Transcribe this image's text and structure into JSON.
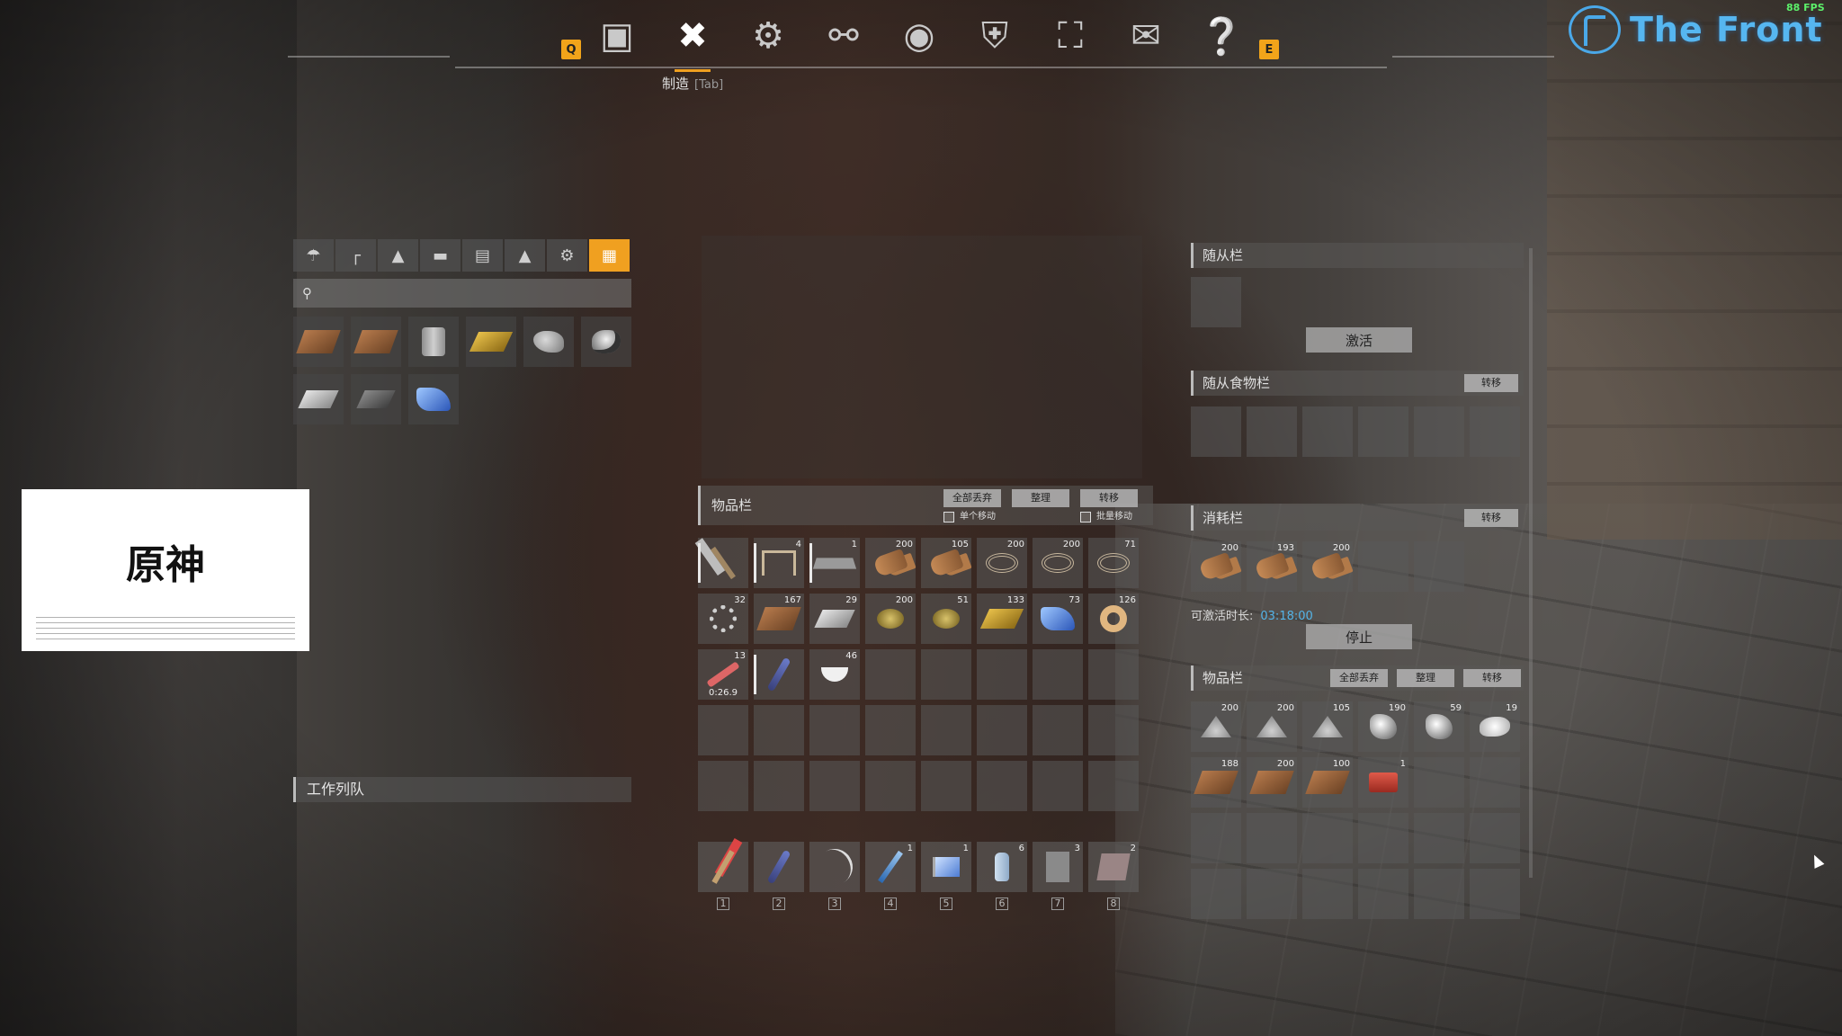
{
  "top_nav": {
    "left_key": "Q",
    "right_key": "E",
    "icons": [
      "backpack-icon",
      "wrench-screwdriver-icon",
      "gear-bolt-icon",
      "share-network-icon",
      "map-pin-icon",
      "shield-badge-icon",
      "world-map-icon",
      "mail-icon",
      "help-icon"
    ],
    "active_label": "制造",
    "active_hint": "[Tab]"
  },
  "brand": {
    "name": "The Front",
    "fps": "88 FPS"
  },
  "craft": {
    "categories": [
      "parachute-icon",
      "gun-icon",
      "statue-icon",
      "tank-icon",
      "crate-icon",
      "campfire-icon",
      "settings-icon",
      "grid-icon"
    ],
    "search_placeholder": "",
    "recipes": [
      "plank",
      "plank",
      "can",
      "gold",
      "ore",
      "coal",
      "iron",
      "steel",
      "blue"
    ],
    "queue_title": "工作列队"
  },
  "white_card": {
    "title": "原神"
  },
  "inventory": {
    "title": "物品栏",
    "btn_drop_all": "全部丢弃",
    "btn_sort": "整理",
    "btn_transfer": "转移",
    "check_single": "单个移动",
    "check_batch": "批量移动",
    "slots": [
      {
        "g": "axe",
        "q": "",
        "dur": true
      },
      {
        "g": "table",
        "q": "4",
        "dur": true
      },
      {
        "g": "slab",
        "q": "1",
        "dur": true
      },
      {
        "g": "wood",
        "q": "200"
      },
      {
        "g": "wood",
        "q": "105"
      },
      {
        "g": "rope",
        "q": "200"
      },
      {
        "g": "rope",
        "q": "200"
      },
      {
        "g": "rope",
        "q": "71"
      },
      {
        "g": "gear",
        "q": "32"
      },
      {
        "g": "plank",
        "q": "167"
      },
      {
        "g": "iron",
        "q": "29"
      },
      {
        "g": "nugget",
        "q": "200"
      },
      {
        "g": "nugget",
        "q": "51"
      },
      {
        "g": "gold",
        "q": "133"
      },
      {
        "g": "blue",
        "q": "73"
      },
      {
        "g": "tape",
        "q": "126"
      },
      {
        "g": "syringe",
        "q": "13",
        "t": "0:26.9"
      },
      {
        "g": "key",
        "q": "",
        "dur": true
      },
      {
        "g": "bowl",
        "q": "46"
      },
      {
        "g": ""
      },
      {
        "g": ""
      },
      {
        "g": ""
      },
      {
        "g": ""
      },
      {
        "g": ""
      },
      {
        "g": ""
      },
      {
        "g": ""
      },
      {
        "g": ""
      },
      {
        "g": ""
      },
      {
        "g": ""
      },
      {
        "g": ""
      },
      {
        "g": ""
      },
      {
        "g": ""
      },
      {
        "g": ""
      },
      {
        "g": ""
      },
      {
        "g": ""
      },
      {
        "g": ""
      },
      {
        "g": ""
      },
      {
        "g": ""
      },
      {
        "g": ""
      },
      {
        "g": ""
      }
    ],
    "hotbar": [
      {
        "g": "torch",
        "q": ""
      },
      {
        "g": "key",
        "q": ""
      },
      {
        "g": "bow",
        "q": ""
      },
      {
        "g": "knife",
        "q": "1"
      },
      {
        "g": "flag",
        "q": "1"
      },
      {
        "g": "bottle",
        "q": "6"
      },
      {
        "g": "cloth",
        "q": "3"
      },
      {
        "g": "book",
        "q": "2"
      }
    ],
    "hotbar_numbers": [
      "1",
      "2",
      "3",
      "4",
      "5",
      "6",
      "7",
      "8"
    ]
  },
  "right": {
    "follower_title": "随从栏",
    "activate_btn": "激活",
    "food_title": "随从食物栏",
    "food_transfer": "转移",
    "consumable_title": "消耗栏",
    "consumable_transfer": "转移",
    "consumables": [
      {
        "g": "wood",
        "q": "200"
      },
      {
        "g": "wood",
        "q": "193"
      },
      {
        "g": "wood",
        "q": "200"
      },
      {
        "g": "",
        "q": ""
      },
      {
        "g": "",
        "q": ""
      }
    ],
    "timer_label": "可激活时长:",
    "timer_value": "03:18:00",
    "stop_btn": "停止",
    "inv_title": "物品栏",
    "inv_drop_all": "全部丢弃",
    "inv_sort": "整理",
    "inv_transfer": "转移",
    "inv_slots": [
      {
        "g": "dust",
        "q": "200"
      },
      {
        "g": "dust",
        "q": "200"
      },
      {
        "g": "dust",
        "q": "105"
      },
      {
        "g": "rock",
        "q": "190"
      },
      {
        "g": "rock",
        "q": "59"
      },
      {
        "g": "white-ore",
        "q": "19"
      },
      {
        "g": "plank",
        "q": "188"
      },
      {
        "g": "plank",
        "q": "200"
      },
      {
        "g": "plank",
        "q": "100"
      },
      {
        "g": "redbox",
        "q": "1"
      },
      {
        "g": "",
        "q": ""
      },
      {
        "g": "",
        "q": ""
      },
      {
        "g": "",
        "q": ""
      },
      {
        "g": "",
        "q": ""
      },
      {
        "g": "",
        "q": ""
      },
      {
        "g": "",
        "q": ""
      },
      {
        "g": "",
        "q": ""
      },
      {
        "g": "",
        "q": ""
      },
      {
        "g": "",
        "q": ""
      },
      {
        "g": "",
        "q": ""
      },
      {
        "g": "",
        "q": ""
      },
      {
        "g": "",
        "q": ""
      },
      {
        "g": "",
        "q": ""
      },
      {
        "g": "",
        "q": ""
      }
    ]
  },
  "colors": {
    "accent": "#f0a020",
    "timer": "#54b4e8",
    "brand": "#56b6f0"
  }
}
